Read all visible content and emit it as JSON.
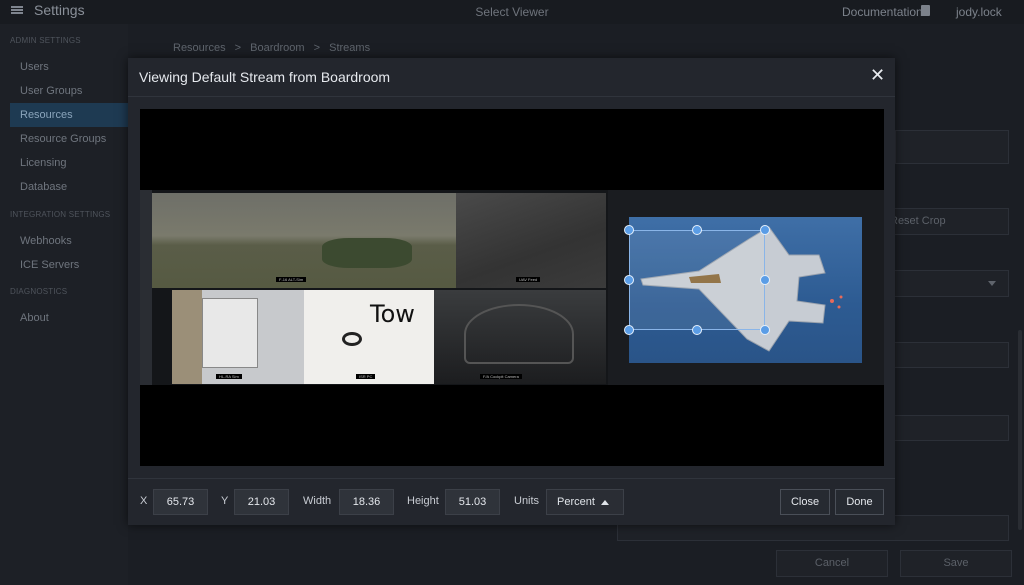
{
  "topbar": {
    "app_title": "Settings",
    "viewer_title": "Select Viewer",
    "documentation": "Documentation",
    "user": "jody.lock"
  },
  "sidebar": {
    "sections": [
      {
        "title": "ADMIN SETTINGS",
        "items": [
          "Users",
          "User Groups",
          "Resources",
          "Resource Groups",
          "Licensing",
          "Database"
        ]
      },
      {
        "title": "INTEGRATION SETTINGS",
        "items": [
          "Webhooks",
          "ICE Servers"
        ]
      },
      {
        "title": "DIAGNOSTICS",
        "items": [
          "About"
        ]
      }
    ],
    "active": "Resources"
  },
  "breadcrumb": {
    "items": [
      "Resources",
      "Boardroom",
      "Streams"
    ],
    "separator": ">"
  },
  "background": {
    "reset_crop": "Reset Crop",
    "cancel": "Cancel",
    "save": "Save"
  },
  "modal": {
    "title": "Viewing Default Stream from Boardroom",
    "crop": {
      "x_label": "X",
      "x": "65.73",
      "y_label": "Y",
      "y": "21.03",
      "width_label": "Width",
      "width": "18.36",
      "height_label": "Height",
      "height": "51.03",
      "units_label": "Units",
      "units": "Percent"
    },
    "buttons": {
      "close": "Close",
      "done": "Done"
    }
  },
  "stream_tiles": {
    "t1": "F-16 ALT-Sim",
    "t2": "UAV Feed",
    "t3": "HL-RA Sim",
    "t4": "ISR PC",
    "t5": "F/A Cockpit Camera",
    "writing": "Tow"
  },
  "colors": {
    "accent": "#5b9de6",
    "active_nav": "#1e3a52",
    "modal_bg": "#23262d"
  }
}
